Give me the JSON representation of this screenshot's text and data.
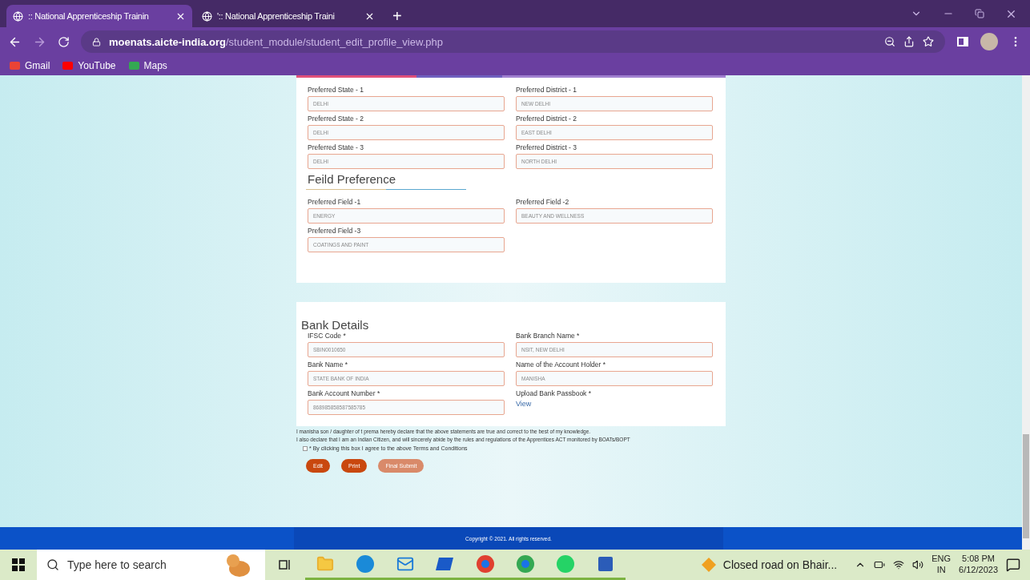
{
  "browser": {
    "tabs": [
      {
        "title": ":: National Apprenticeship Trainin",
        "selected": true
      },
      {
        "title": "':: National Apprenticeship Traini",
        "selected": false
      }
    ],
    "new_tab": "+",
    "url": {
      "domain": "moenats.aicte-india.org",
      "path": "/student_module/student_edit_profile_view.php"
    },
    "bookmarks": [
      "Gmail",
      "YouTube",
      "Maps"
    ]
  },
  "location_preferences": [
    {
      "label": "Preferred State - 1",
      "value": "DELHI"
    },
    {
      "label": "Preferred District - 1",
      "value": "NEW DELHI"
    },
    {
      "label": "Preferred State - 2",
      "value": "DELHI"
    },
    {
      "label": "Preferred District - 2",
      "value": "EAST DELHI"
    },
    {
      "label": "Preferred State - 3",
      "value": "DELHI"
    },
    {
      "label": "Preferred District - 3",
      "value": "NORTH DELHI"
    }
  ],
  "field_heading": "Feild Preference",
  "field_preferences": [
    {
      "label": "Preferred Field -1",
      "value": "ENERGY"
    },
    {
      "label": "Preferred Field -2",
      "value": "BEAUTY AND WELLNESS"
    },
    {
      "label": "Preferred Field -3",
      "value": "COATINGS AND PAINT"
    }
  ],
  "bank_heading": "Bank Details",
  "bank_fields": [
    {
      "kind": "input",
      "label": "IFSC Code *",
      "value": "SBIN0010650"
    },
    {
      "kind": "input",
      "label": "Bank Branch Name *",
      "value": "NSIT, NEW DELHI"
    },
    {
      "kind": "input",
      "label": "Bank Name *",
      "value": "STATE BANK OF INDIA"
    },
    {
      "kind": "input",
      "label": "Name of the Account Holder *",
      "value": "MANISHA"
    },
    {
      "kind": "input",
      "label": "Bank Account Number *",
      "value": "868985858587585785"
    },
    {
      "kind": "link",
      "label": "Upload Bank Passbook *",
      "value": "View"
    }
  ],
  "declaration": [
    "I manisha son / daughter of t prema hereby declare that the above statements are true and correct to the best of my knowledge.",
    "I also declare that I am an Indian Citizen, and will sincerely abide by the rules and regulations of the Apprentices ACT monitored by BOATs/BOPT"
  ],
  "terms": {
    "label": "* By clicking this box I agree to the above Terms and Conditions",
    "checked": false
  },
  "buttons": [
    {
      "label": "Edit",
      "disabled": false
    },
    {
      "label": "Print",
      "disabled": false
    },
    {
      "label": "Final Submit",
      "disabled": true
    }
  ],
  "footer": "Copyright © 2021. All rights reserved.",
  "taskbar": {
    "search_placeholder": "Type here to search",
    "news": "Closed road on Bhair...",
    "language": "ENG",
    "region": "IN",
    "time": "5:08 PM",
    "date": "6/12/2023"
  }
}
